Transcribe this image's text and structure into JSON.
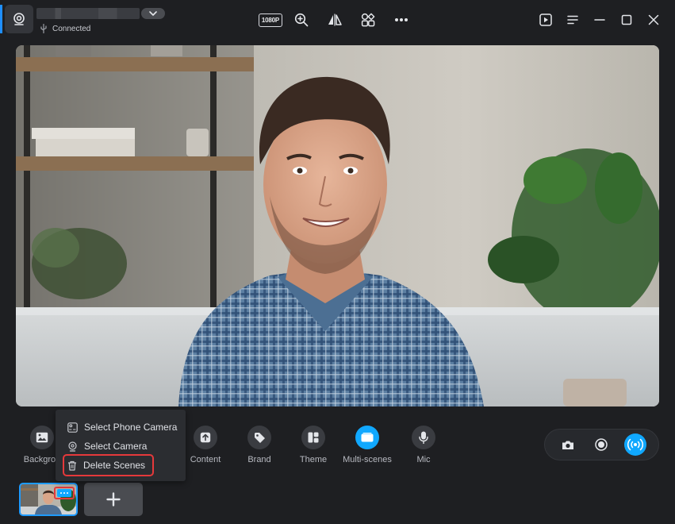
{
  "header": {
    "connection_status": "Connected",
    "resolution": "1080P"
  },
  "toolbar": {
    "features": [
      {
        "label": "Backgrou",
        "icon": "image-icon"
      },
      {
        "label": "Content",
        "icon": "upload-icon"
      },
      {
        "label": "Brand",
        "icon": "tag-icon"
      },
      {
        "label": "Theme",
        "icon": "theme-icon"
      },
      {
        "label": "Multi-scenes",
        "icon": "multi-scenes-icon",
        "active": true
      },
      {
        "label": "Mic",
        "icon": "mic-icon"
      }
    ]
  },
  "context_menu": {
    "items": [
      {
        "label": "Select Phone Camera",
        "icon": "phone-camera-icon"
      },
      {
        "label": "Select Camera",
        "icon": "camera-icon"
      },
      {
        "label": "Delete Scenes",
        "icon": "trash-icon",
        "highlighted": true
      }
    ]
  },
  "colors": {
    "accent": "#10a8ff",
    "highlight": "#e5393b",
    "background": "#1e1f22"
  }
}
